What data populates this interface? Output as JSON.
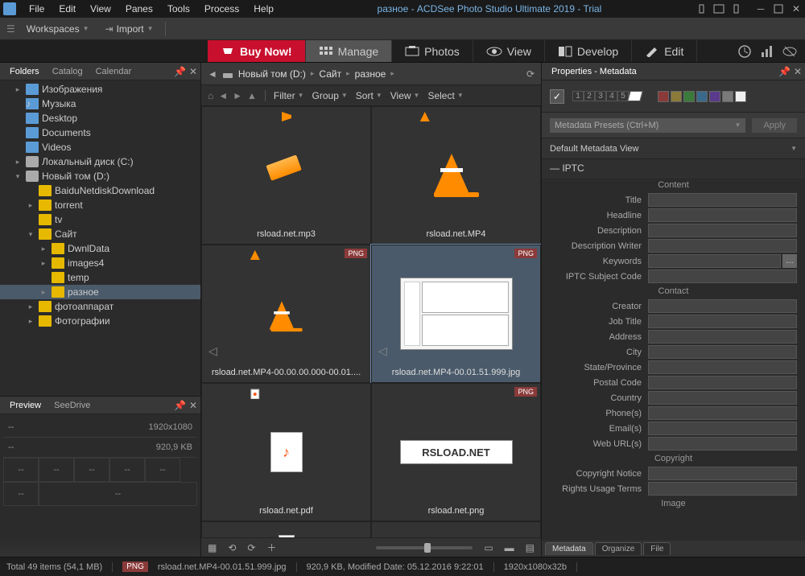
{
  "titlebar": {
    "title": "разное - ACDSee Photo Studio Ultimate 2019 - Trial"
  },
  "menu": {
    "file": "File",
    "edit": "Edit",
    "view": "View",
    "panes": "Panes",
    "tools": "Tools",
    "process": "Process",
    "help": "Help"
  },
  "toolbar1": {
    "workspaces": "Workspaces",
    "import": "Import"
  },
  "modes": {
    "buy": "Buy Now!",
    "manage": "Manage",
    "photos": "Photos",
    "view": "View",
    "develop": "Develop",
    "edit": "Edit"
  },
  "folders": {
    "tab1": "Folders",
    "tab2": "Catalog",
    "tab3": "Calendar",
    "tree": [
      {
        "label": "Изображения"
      },
      {
        "label": "Музыка"
      },
      {
        "label": "Desktop"
      },
      {
        "label": "Documents"
      },
      {
        "label": "Videos"
      },
      {
        "label": "Локальный диск (C:)"
      },
      {
        "label": "Новый том (D:)"
      },
      {
        "label": "BaiduNetdiskDownload"
      },
      {
        "label": "torrent"
      },
      {
        "label": "tv"
      },
      {
        "label": "Сайт"
      },
      {
        "label": "DwnlData"
      },
      {
        "label": "images4"
      },
      {
        "label": "temp"
      },
      {
        "label": "разное"
      },
      {
        "label": "фотоаппарат"
      },
      {
        "label": "Фотографии"
      }
    ]
  },
  "preview": {
    "tab1": "Preview",
    "tab2": "SeeDrive",
    "dims": "1920x1080",
    "size": "920,9 KB",
    "dash": "--"
  },
  "breadcrumb": {
    "a": "Новый том (D:)",
    "b": "Сайт",
    "c": "разное"
  },
  "filterbar": {
    "filter": "Filter",
    "group": "Group",
    "sort": "Sort",
    "view": "View",
    "select": "Select"
  },
  "thumbs": {
    "t1": "rsload.net.mp3",
    "t2": "rsload.net.MP4",
    "t3": "rsload.net.MP4-00.00.00.000-00.01....",
    "t4": "rsload.net.MP4-00.01.51.999.jpg",
    "t5": "rsload.net.pdf",
    "t6": "rsload.net.png",
    "png": "PNG",
    "logo": "RSLOAD.NET"
  },
  "properties": {
    "title": "Properties - Metadata",
    "presets": "Metadata Presets (Ctrl+M)",
    "apply": "Apply",
    "view": "Default Metadata View",
    "iptc": "IPTC",
    "content": "Content",
    "contact": "Contact",
    "copyright": "Copyright",
    "image": "Image",
    "fields": {
      "title": "Title",
      "headline": "Headline",
      "description": "Description",
      "descwriter": "Description Writer",
      "keywords": "Keywords",
      "subjcode": "IPTC Subject Code",
      "creator": "Creator",
      "jobtitle": "Job Title",
      "address": "Address",
      "city": "City",
      "state": "State/Province",
      "postal": "Postal Code",
      "country": "Country",
      "phones": "Phone(s)",
      "emails": "Email(s)",
      "weburls": "Web URL(s)",
      "cnotice": "Copyright Notice",
      "rights": "Rights Usage Terms"
    },
    "tabs": {
      "meta": "Metadata",
      "org": "Organize",
      "file": "File"
    },
    "swatches": [
      "#8b3a3a",
      "#8b7a3a",
      "#3a7a3a",
      "#3a6a8b",
      "#5a3a8b",
      "#7a7a7a",
      "#efefef"
    ]
  },
  "statusbar": {
    "total": "Total 49 items (54,1 MB)",
    "png": "PNG",
    "file": "rsload.net.MP4-00.01.51.999.jpg",
    "info": "920,9 KB, Modified Date: 05.12.2016 9:22:01",
    "dims": "1920x1080x32b"
  }
}
